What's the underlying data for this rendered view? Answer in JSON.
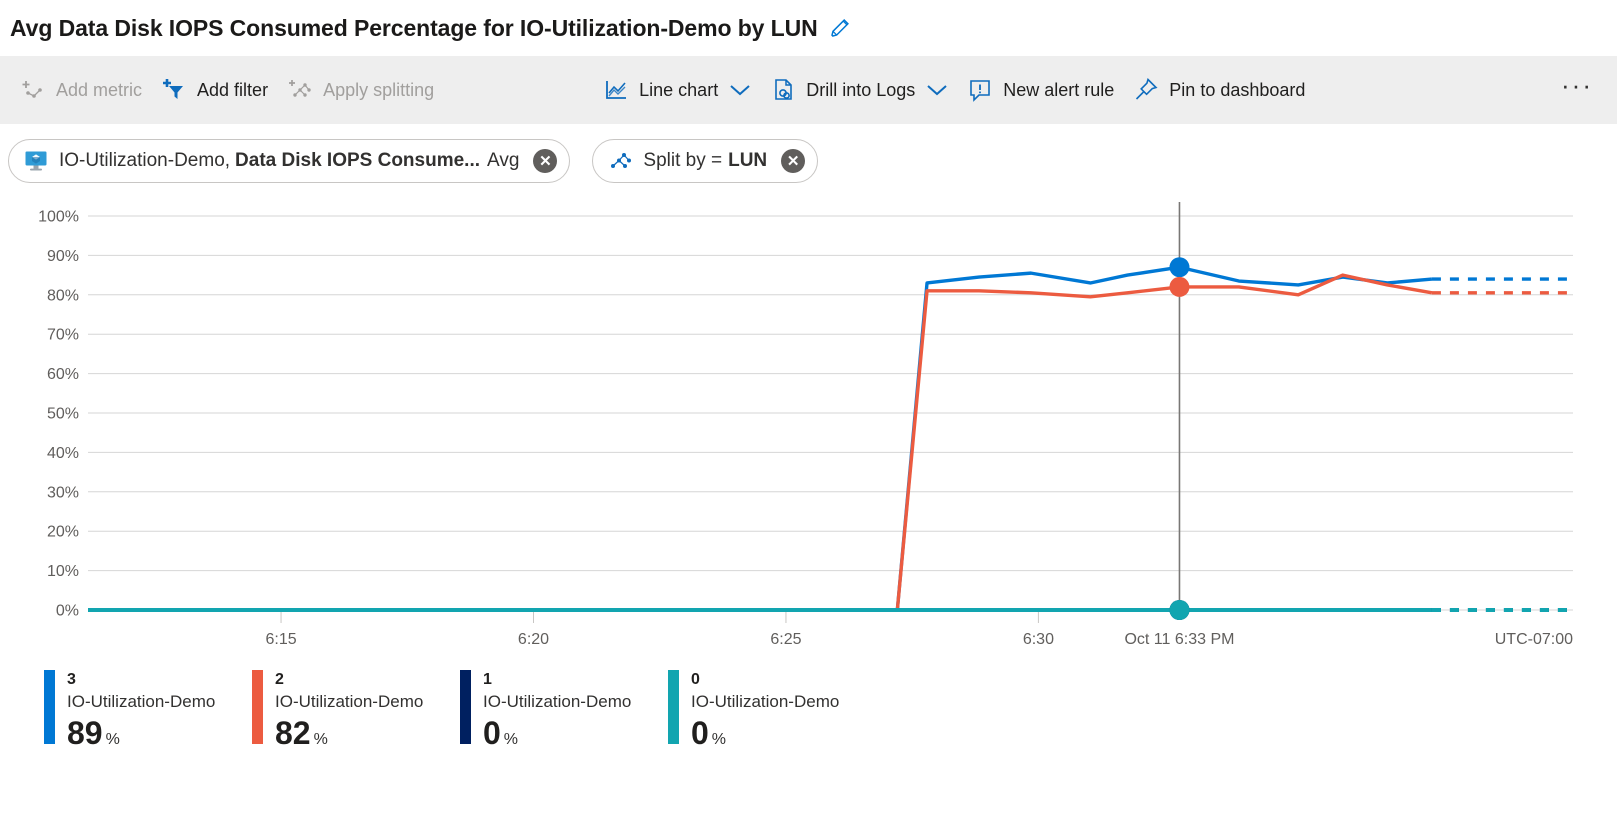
{
  "header": {
    "title": "Avg Data Disk IOPS Consumed Percentage for IO-Utilization-Demo by LUN",
    "edit_icon": "pencil-icon"
  },
  "toolbar": {
    "items": [
      {
        "label": "Add metric",
        "icon": "add-metric-icon",
        "disabled": true,
        "caret": false
      },
      {
        "label": "Add filter",
        "icon": "add-filter-icon",
        "disabled": false,
        "caret": false
      },
      {
        "label": "Apply splitting",
        "icon": "apply-splitting-icon",
        "disabled": true,
        "caret": false
      },
      {
        "label": "Line chart",
        "icon": "line-chart-icon",
        "disabled": false,
        "caret": true
      },
      {
        "label": "Drill into Logs",
        "icon": "drill-into-logs-icon",
        "disabled": false,
        "caret": true
      },
      {
        "label": "New alert rule",
        "icon": "new-alert-rule-icon",
        "disabled": false,
        "caret": false
      },
      {
        "label": "Pin to dashboard",
        "icon": "pin-icon",
        "disabled": false,
        "caret": false
      }
    ],
    "overflow_label": "···"
  },
  "chips": [
    {
      "icon": "virtual-machine-icon",
      "resource": "IO-Utilization-Demo,",
      "metric": "Data Disk IOPS Consume...",
      "aggregation": "Avg",
      "close_label": "✕"
    },
    {
      "icon": "splitting-icon",
      "prefix": "Split by =",
      "value": "LUN",
      "close_label": "✕"
    }
  ],
  "chart_data": {
    "type": "line",
    "title": "Avg Data Disk IOPS Consumed Percentage for IO-Utilization-Demo by LUN",
    "xlabel": "",
    "ylabel": "",
    "ylim": [
      0,
      100
    ],
    "ytick_labels": [
      "100%",
      "90%",
      "80%",
      "70%",
      "60%",
      "50%",
      "40%",
      "30%",
      "20%",
      "10%",
      "0%"
    ],
    "ytick_values": [
      100,
      90,
      80,
      70,
      60,
      50,
      40,
      30,
      20,
      10,
      0
    ],
    "xtick_labels": [
      "6:15",
      "6:20",
      "6:25",
      "6:30"
    ],
    "xtick_positions": [
      0.13,
      0.3,
      0.47,
      0.64
    ],
    "grid": true,
    "legend_position": "bottom",
    "timezone_label": "UTC-07:00",
    "crosshair_label": "Oct 11 6:33 PM",
    "crosshair_x": 0.735,
    "forecast_start": 0.905,
    "series": [
      {
        "name": "3",
        "resource": "IO-Utilization-Demo",
        "color": "#0078d4",
        "current_value": "89",
        "unit": "%",
        "highlight_value": 87,
        "x": [
          0.0,
          0.1,
          0.2,
          0.3,
          0.4,
          0.5,
          0.545,
          0.565,
          0.6,
          0.635,
          0.675,
          0.7,
          0.735,
          0.775,
          0.815,
          0.845,
          0.875,
          0.905,
          1.0
        ],
        "values": [
          0,
          0,
          0,
          0,
          0,
          0,
          0,
          83,
          84.5,
          85.5,
          83,
          85,
          87,
          83.5,
          82.5,
          84.5,
          83,
          84,
          84
        ]
      },
      {
        "name": "2",
        "resource": "IO-Utilization-Demo",
        "color": "#ec5b40",
        "current_value": "82",
        "unit": "%",
        "highlight_value": 82,
        "x": [
          0.0,
          0.1,
          0.2,
          0.3,
          0.4,
          0.5,
          0.545,
          0.565,
          0.6,
          0.635,
          0.675,
          0.7,
          0.735,
          0.775,
          0.815,
          0.845,
          0.875,
          0.905,
          1.0
        ],
        "values": [
          0,
          0,
          0,
          0,
          0,
          0,
          0,
          81,
          81,
          80.5,
          79.5,
          80.5,
          82,
          82,
          80,
          85,
          82.5,
          80.5,
          80.5
        ]
      },
      {
        "name": "1",
        "resource": "IO-Utilization-Demo",
        "color": "#002060",
        "current_value": "0",
        "unit": "%",
        "highlight_value": 0,
        "x": [
          0.0,
          1.0
        ],
        "values": [
          0,
          0
        ]
      },
      {
        "name": "0",
        "resource": "IO-Utilization-Demo",
        "color": "#12a5b0",
        "current_value": "0",
        "unit": "%",
        "highlight_value": 0,
        "x": [
          0.0,
          1.0
        ],
        "values": [
          0,
          0
        ]
      }
    ]
  }
}
